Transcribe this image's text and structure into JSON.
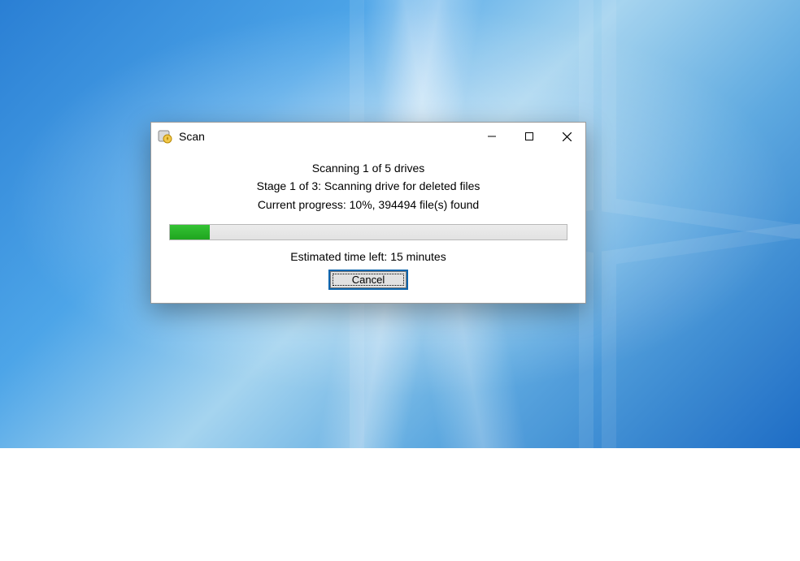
{
  "dialog": {
    "title": "Scan",
    "scanning_line": "Scanning 1 of 5 drives",
    "stage_line": "Stage 1 of 3: Scanning drive for deleted files",
    "progress_line": "Current progress: 10%, 394494 file(s) found",
    "progress_percent": 10,
    "eta_line": "Estimated time left: 15 minutes",
    "cancel_label": "Cancel"
  }
}
